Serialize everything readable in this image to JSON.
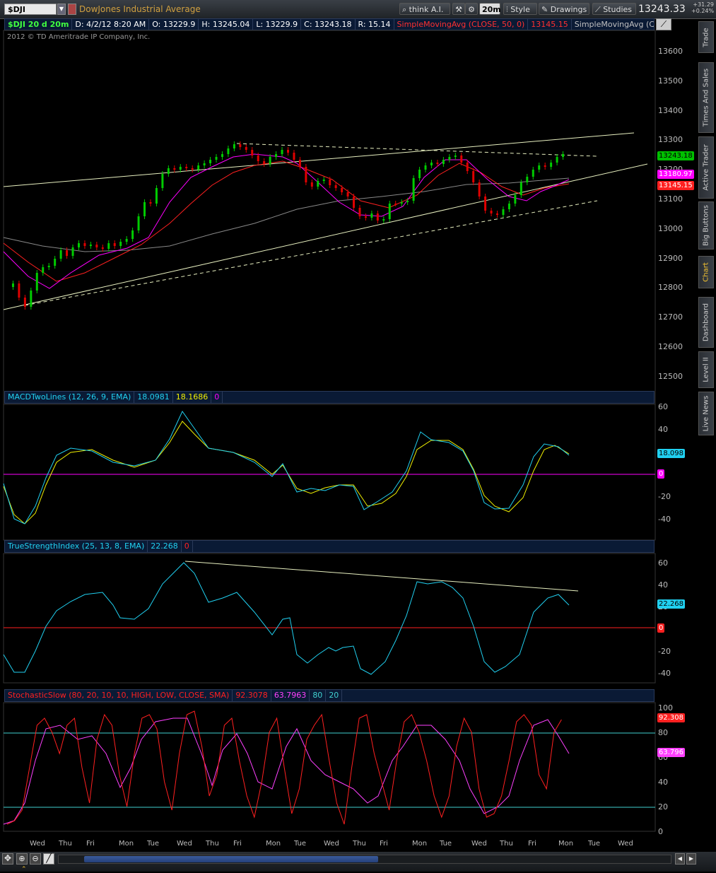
{
  "toolbar": {
    "symbol": "$DJI",
    "description": "DowJones Industrial Average",
    "think_label": "think A.I.",
    "interval_label": "20m",
    "style_label": "Style",
    "drawings_label": "Drawings",
    "studies_label": "Studies",
    "last_price": "13243.33",
    "change": "+31.29",
    "change_pct": "+0.24%"
  },
  "info_row": {
    "symbol_period": "$DJI 20 d 20m",
    "date": "D: 4/2/12 8:20 AM",
    "open": "O: 13229.9",
    "high": "H: 13245.04",
    "low": "L: 13229.9",
    "close": "C: 13243.18",
    "range": "R: 15.14",
    "sma50_label": "SimpleMovingAvg (CLOSE, 50, 0)",
    "sma50_value": "13145.15",
    "sma_other_label": "SimpleMovingAvg (CLO..."
  },
  "copyright": "2012 © TD Ameritrade IP Company, Inc.",
  "price_axis": [
    "13600",
    "13500",
    "13400",
    "13300",
    "13200",
    "13100",
    "13000",
    "12900",
    "12800",
    "12700",
    "12600",
    "12500"
  ],
  "price_badges": {
    "last": "13243.18",
    "sma_magenta": "13180.97",
    "sma_red": "13145.15"
  },
  "macd": {
    "header": "MACDTwoLines (12, 26, 9, EMA)",
    "value1": "18.0981",
    "value2": "18.1686",
    "value3": "0",
    "axis": [
      "60",
      "40",
      "20",
      "0",
      "-20",
      "-40"
    ],
    "badge_value": "18.098",
    "badge_zero": "0"
  },
  "tsi": {
    "header": "TrueStrengthIndex (25, 13, 8, EMA)",
    "value1": "22.268",
    "value2": "0",
    "axis": [
      "60",
      "40",
      "20",
      "0",
      "-20",
      "-40"
    ],
    "badge_value": "22.268",
    "badge_zero": "0"
  },
  "stoch": {
    "header": "StochasticSlow (80, 20, 10, 10, HIGH, LOW, CLOSE, SMA)",
    "value1": "92.3078",
    "value2": "63.7963",
    "value3": "80",
    "value4": "20",
    "axis": [
      "100",
      "80",
      "60",
      "40",
      "20",
      "0"
    ],
    "badge_k": "92.308",
    "badge_d": "63.796"
  },
  "x_axis_days": [
    "Wed",
    "Thu",
    "Fri",
    "Mon",
    "Tue",
    "Wed",
    "Thu",
    "Fri",
    "Mon",
    "Tue",
    "Wed",
    "Thu",
    "Fri",
    "Mon",
    "Tue",
    "Wed",
    "Thu",
    "Fri",
    "Mon",
    "Tue",
    "Wed"
  ],
  "side_tabs": [
    "Trade",
    "Times And Sales",
    "Active Trader",
    "Big Buttons",
    "Chart",
    "Dashboard",
    "Level II",
    "Live News"
  ],
  "colors": {
    "price_up": "#00cc00",
    "price_down": "#e00000",
    "sma_magenta": "#ff00ff",
    "sma_red": "#ff2020",
    "sma_gray": "#888888",
    "trendline": "#e8f0c0",
    "macd_cyan": "#20d0f0",
    "macd_yellow": "#f0f000",
    "stoch_red": "#ff2020",
    "stoch_magenta": "#ff40ff",
    "ref_cyan": "#40d0d0"
  }
}
